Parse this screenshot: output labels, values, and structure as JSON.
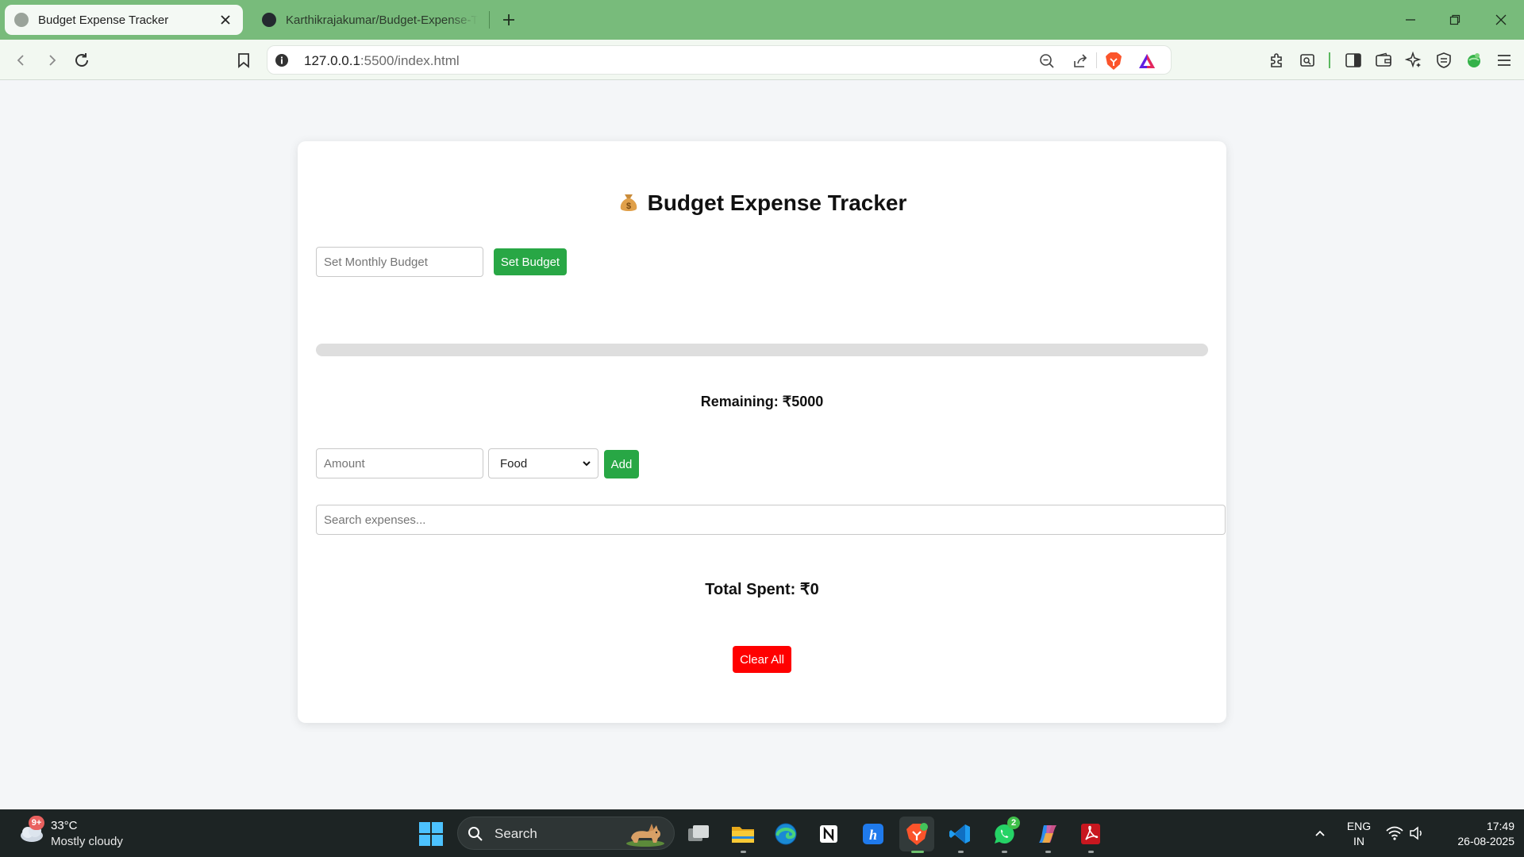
{
  "browser": {
    "tabs": [
      {
        "title": "Budget Expense Tracker",
        "active": true
      },
      {
        "title": "Karthikrajakumar/Budget-Expense-Tracker",
        "active": false
      }
    ],
    "address": {
      "host": "127.0.0.1",
      "path": ":5500/index.html"
    },
    "icons": {
      "back": "back-arrow-icon",
      "forward": "forward-arrow-icon",
      "reload": "reload-icon",
      "bookmark": "bookmark-icon",
      "site_info": "info-icon",
      "zoom": "zoom-out-icon",
      "share": "share-icon",
      "brave_shields": "brave-lion-icon",
      "rewards": "rewards-triangle-icon",
      "extensions": "puzzle-piece-icon",
      "screenshot": "capture-icon",
      "sidebar": "sidebar-icon",
      "wallet": "wallet-icon",
      "leo": "sparkle-icon",
      "vpn": "vpn-shield-icon",
      "profile": "green-extension-icon",
      "menu": "hamburger-menu-icon"
    },
    "colors": {
      "tab_strip": "#78bb7b",
      "toolbar": "#f2f8f1"
    }
  },
  "app": {
    "title": "Budget Expense Tracker",
    "title_icon": "money-bag-icon",
    "budget": {
      "placeholder": "Set Monthly Budget",
      "button_label": "Set Budget"
    },
    "progress_fraction": 0,
    "remaining_text": "Remaining: ₹5000",
    "expense": {
      "amount_placeholder": "Amount",
      "category_selected": "Food",
      "add_label": "Add"
    },
    "search_placeholder": "Search expenses...",
    "total_text": "Total Spent: ₹0",
    "clear_label": "Clear All",
    "colors": {
      "primary": "#28a745",
      "danger": "#ff0000"
    }
  },
  "taskbar": {
    "weather": {
      "badge": "9+",
      "temp": "33°C",
      "condition": "Mostly cloudy"
    },
    "search_label": "Search",
    "apps": [
      {
        "name": "task-view-icon"
      },
      {
        "name": "file-explorer-icon"
      },
      {
        "name": "edge-icon"
      },
      {
        "name": "notion-icon"
      },
      {
        "name": "hackerrank-icon"
      },
      {
        "name": "brave-browser-icon",
        "active": true
      },
      {
        "name": "vscode-icon"
      },
      {
        "name": "whatsapp-icon",
        "badge": "2"
      },
      {
        "name": "copilot-icon"
      },
      {
        "name": "acrobat-icon"
      }
    ],
    "language": {
      "line1": "ENG",
      "line2": "IN"
    },
    "clock": {
      "time": "17:49",
      "date": "26-08-2025"
    }
  }
}
